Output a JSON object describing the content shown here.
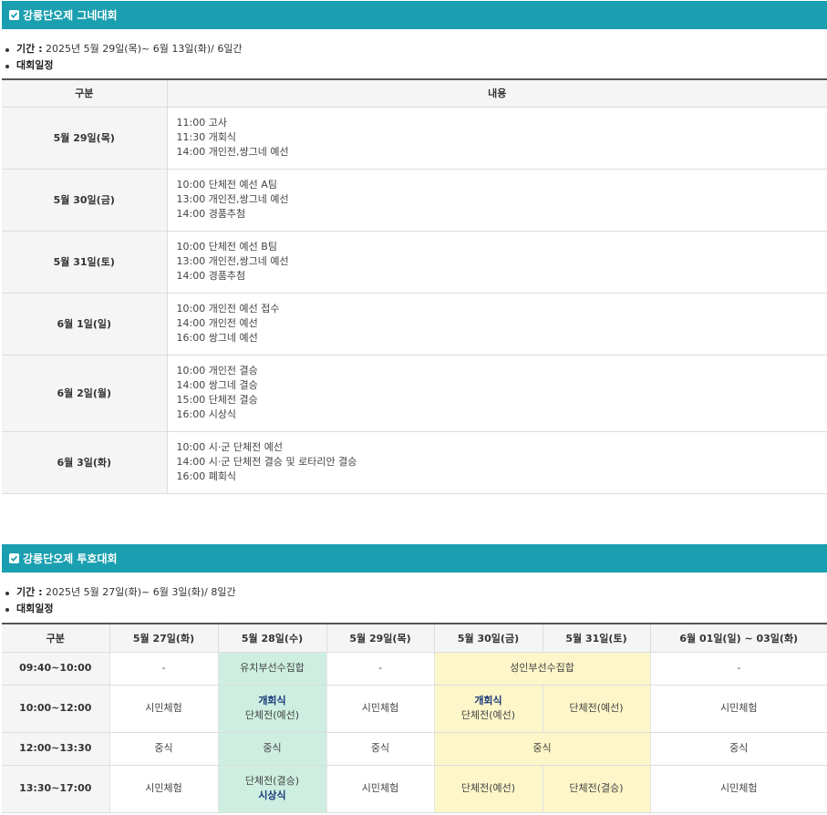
{
  "section1": {
    "title": "강릉단오제 그네대회",
    "period_label": "기간 :",
    "period_value": " 2025년 5월 29일(목)~ 6월 13일(화)/ 6일간",
    "schedule_label": "대회일정",
    "table": {
      "headers": [
        "구분",
        "내용"
      ],
      "rows": [
        {
          "day": "5월 29일(목)",
          "lines": [
            "11:00 고사",
            "11:30 개회식",
            "14:00 개인전,쌍그네 예선"
          ]
        },
        {
          "day": "5월 30일(금)",
          "lines": [
            "10:00 단체전 예선 A팀",
            "13:00 개인전,쌍그네 예선",
            "14:00 경품추첨"
          ]
        },
        {
          "day": "5월 31일(토)",
          "lines": [
            "10:00 단체전 예선 B팀",
            "13:00 개인전,쌍그네 예선",
            "14:00 경품추첨"
          ]
        },
        {
          "day": "6월 1일(일)",
          "lines": [
            "10:00 개인전 예선 접수",
            "14:00 개인전 예선",
            "16:00 쌍그네 예선"
          ]
        },
        {
          "day": "6월 2일(월)",
          "lines": [
            "10:00 개인전 결승",
            "14:00 쌍그네 결승",
            "15:00 단체전 결승",
            "16:00 시상식"
          ]
        },
        {
          "day": "6월 3일(화)",
          "lines": [
            "10:00 시·군 단체전 예선",
            "14:00 시·군 단체전 결승 및 로타리안 결승",
            "16:00 폐회식"
          ]
        }
      ]
    }
  },
  "section2": {
    "title": "강릉단오제 투호대회",
    "period_label": "기간 :",
    "period_value": " 2025년 5월 27일(화)~ 6월 3일(화)/ 8일간",
    "schedule_label": "대회일정",
    "table": {
      "headers": [
        "구분",
        "5월 27일(화)",
        "5월 28일(수)",
        "5월 29일(목)",
        "5월 30일(금)",
        "5월 31일(토)",
        "6월 01일(일) ~ 03일(화)"
      ],
      "row1": {
        "time": "09:40~10:00",
        "c1": "-",
        "c2": "유치부선수집합",
        "c3": "-",
        "c45": "성인부선수집합",
        "c6": "-"
      },
      "row2": {
        "time": "10:00~12:00",
        "c1": "시민체험",
        "c2a": "개회식",
        "c2b": "단체전(예선)",
        "c3": "시민체험",
        "c4a": "개회식",
        "c4b": "단체전(예선)",
        "c5": "단체전(예선)",
        "c6": "시민체험"
      },
      "row3": {
        "time": "12:00~13:30",
        "c1": "중식",
        "c2": "중식",
        "c3": "중식",
        "c45": "중식",
        "c6": "중식"
      },
      "row4": {
        "time": "13:30~17:00",
        "c1": "시민체험",
        "c2a": "단체전(결승)",
        "c2b": "시상식",
        "c3": "시민체험",
        "c4": "단체전(예선)",
        "c5": "단체전(결승)",
        "c6": "시민체험"
      }
    }
  },
  "colors": {
    "header_bg": "#1a9fb0",
    "highlight_green": "#cdeee0",
    "highlight_yellow": "#fdf6c8"
  }
}
